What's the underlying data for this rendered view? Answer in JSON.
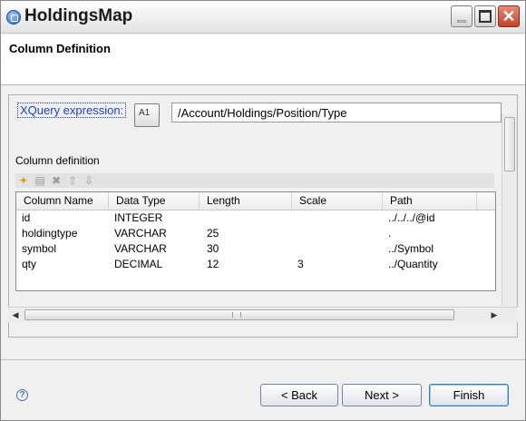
{
  "window": {
    "title": "HoldingsMap",
    "controls": {
      "minimize": "minimize",
      "maximize": "maximize",
      "close": "✕"
    }
  },
  "header": {
    "title": "Column Definition"
  },
  "xquery": {
    "label": "XQuery expression:",
    "button_icon": "A1",
    "value": "/Account/Holdings/Position/Type"
  },
  "column_definition": {
    "label": "Column definition",
    "toolbar": [
      {
        "name": "add-icon",
        "glyph": "✦"
      },
      {
        "name": "edit-icon",
        "glyph": "▤"
      },
      {
        "name": "delete-icon",
        "glyph": "✖"
      },
      {
        "name": "move-up-icon",
        "glyph": "⇧"
      },
      {
        "name": "move-down-icon",
        "glyph": "⇩"
      }
    ],
    "columns": [
      "Column Name",
      "Data Type",
      "Length",
      "Scale",
      "Path"
    ],
    "rows": [
      [
        "id",
        "INTEGER",
        "",
        "",
        "../../../@id"
      ],
      [
        "holdingtype",
        "VARCHAR",
        "25",
        "",
        "."
      ],
      [
        "symbol",
        "VARCHAR",
        "30",
        "",
        "../Symbol"
      ],
      [
        "qty",
        "DECIMAL",
        "12",
        "3",
        "../Quantity"
      ]
    ]
  },
  "footer": {
    "help_icon": "?",
    "back_label": "< Back",
    "next_label": "Next >",
    "finish_label": "Finish"
  }
}
